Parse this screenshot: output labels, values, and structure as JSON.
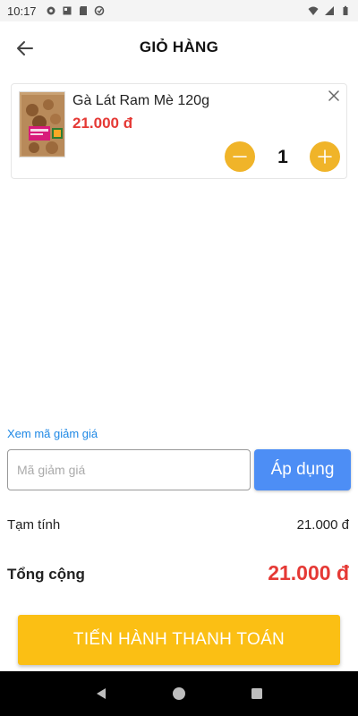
{
  "status_bar": {
    "time": "10:17",
    "icons_left": [
      "gear-icon",
      "news-icon",
      "sd-card-icon",
      "sync-icon"
    ],
    "icons_right": [
      "wifi-icon",
      "signal-icon",
      "battery-icon"
    ]
  },
  "header": {
    "title": "GIỎ HÀNG",
    "back_icon": "arrow-left-icon"
  },
  "cart": {
    "items": [
      {
        "name": "Gà Lát Ram Mè 120g",
        "price": "21.000 đ",
        "quantity": "1"
      }
    ]
  },
  "coupon": {
    "link_label": "Xem mã giảm giá",
    "placeholder": "Mã giảm giá",
    "value": "",
    "apply_label": "Áp dụng"
  },
  "totals": {
    "subtotal_label": "Tạm tính",
    "subtotal_value": "21.000 đ",
    "total_label": "Tổng cộng",
    "total_value": "21.000 đ"
  },
  "checkout": {
    "label": "TIẾN HÀNH THANH TOÁN"
  },
  "nav": {
    "icons": [
      "nav-back-icon",
      "nav-home-icon",
      "nav-recent-icon"
    ]
  },
  "colors": {
    "accent_yellow": "#fbbf14",
    "qty_button": "#f0b429",
    "price_red": "#e53935",
    "link_blue": "#1e88e5",
    "apply_blue": "#4d8ef5"
  }
}
